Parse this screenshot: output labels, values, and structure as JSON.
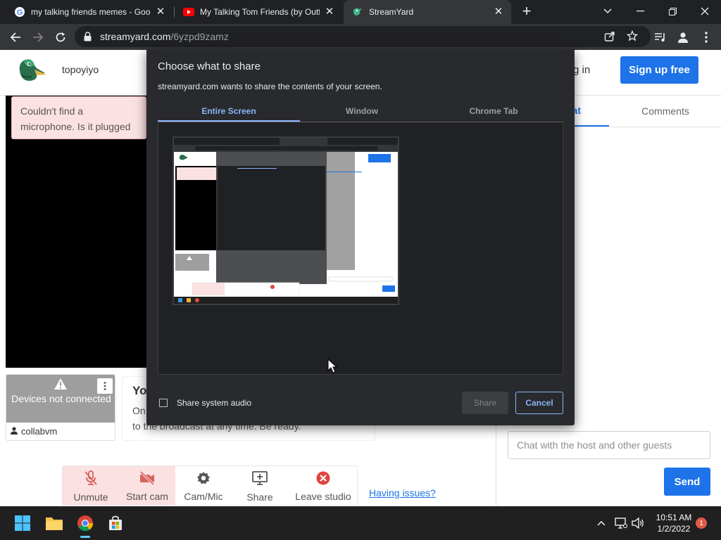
{
  "browser": {
    "tabs": [
      {
        "title": "my talking friends memes - Goog",
        "favicon": "google-icon"
      },
      {
        "title": "My Talking Tom Friends (by Outfi",
        "favicon": "youtube-icon"
      },
      {
        "title": "StreamYard",
        "favicon": "streamyard-icon"
      }
    ],
    "url_host": "streamyard.com",
    "url_path": "/6yzpd9zamz"
  },
  "header": {
    "username": "topoyiyo",
    "login_partial": "g in",
    "signup_label": "Sign up free"
  },
  "stage": {
    "mic_alert": "Couldn't find a microphone. Is it plugged in?"
  },
  "device_card": {
    "status": "Devices not connected",
    "user": "collabvm"
  },
  "info_card": {
    "title": "Yo",
    "desc_line1": "On",
    "desc_line2": "to the broadcast at any time. Be ready."
  },
  "controls": [
    {
      "label": "Unmute",
      "icon": "mic-off-icon"
    },
    {
      "label": "Start cam",
      "icon": "camera-off-icon"
    },
    {
      "label": "Cam/Mic",
      "icon": "gear-icon"
    },
    {
      "label": "Share",
      "icon": "screen-share-icon"
    },
    {
      "label": "Leave studio",
      "icon": "leave-icon"
    }
  ],
  "having_issues": "Having issues?",
  "sidebar": {
    "tabs": [
      "at",
      "Comments"
    ],
    "chat_placeholder": "Chat with the host and other guests",
    "send_label": "Send"
  },
  "dialog": {
    "title": "Choose what to share",
    "subtitle": "streamyard.com wants to share the contents of your screen.",
    "tabs": [
      "Entire Screen",
      "Window",
      "Chrome Tab"
    ],
    "audio_label": "Share system audio",
    "share_label": "Share",
    "cancel_label": "Cancel"
  },
  "taskbar": {
    "time": "10:51 AM",
    "date": "1/2/2022",
    "notifications": "1"
  },
  "colors": {
    "accent": "#1e73e8",
    "dialog_bg": "#292a2d",
    "dialog_accent": "#8ab4f8",
    "alert_bg": "#fbe1e1",
    "leave_red": "#e0443e"
  }
}
